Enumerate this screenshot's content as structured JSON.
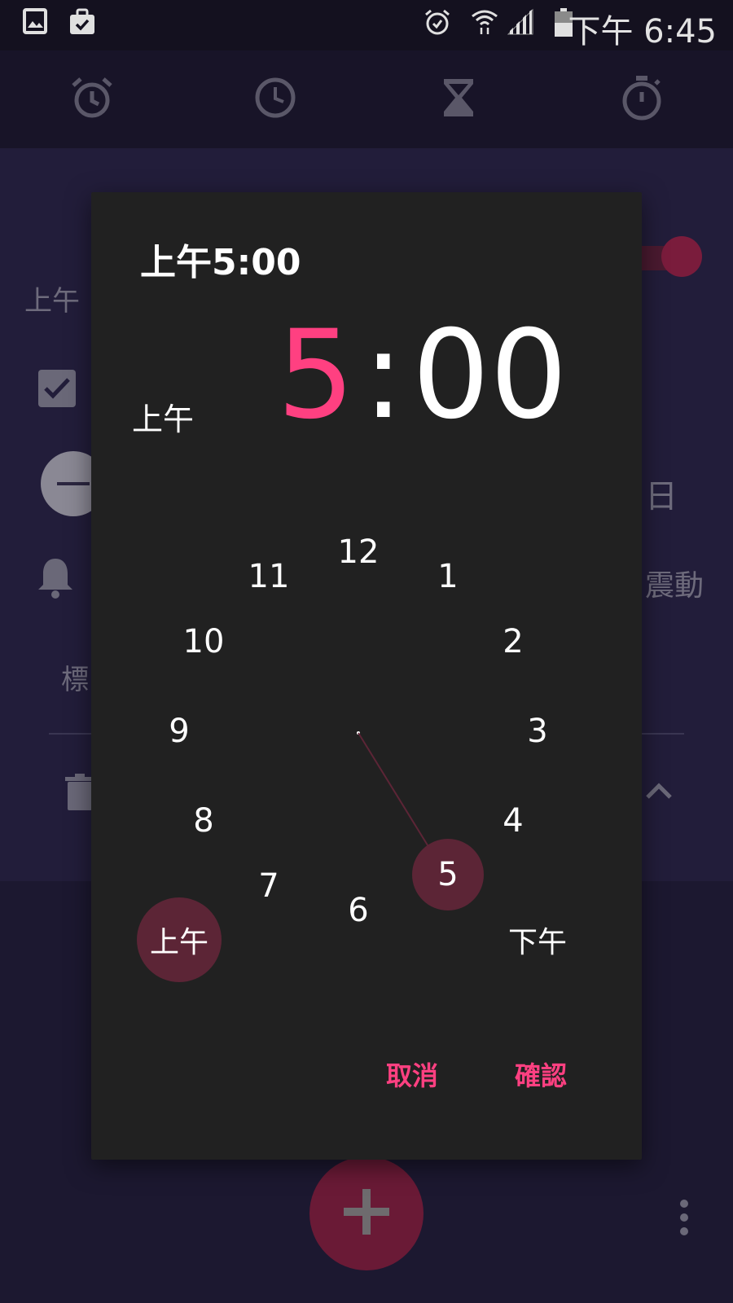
{
  "status_bar": {
    "time": "下午 6:45",
    "left_icons": [
      "image-icon",
      "briefcase-check-icon"
    ],
    "right_icons": [
      "alarm-icon",
      "wifi-icon",
      "signal-icon",
      "battery-icon"
    ]
  },
  "tabs": [
    {
      "icon": "alarm-icon"
    },
    {
      "icon": "clock-icon"
    },
    {
      "icon": "hourglass-icon"
    },
    {
      "icon": "stopwatch-icon"
    }
  ],
  "background": {
    "ampm_fragment": "上午",
    "day_fragment": "日",
    "vibrate_label": "震動",
    "label_fragment": "標"
  },
  "dialog": {
    "title": "上午5:00",
    "ampm_indicator": "上午",
    "hour": "5",
    "separator": ":",
    "minutes": "00",
    "clock_numbers": [
      "12",
      "1",
      "2",
      "3",
      "4",
      "5",
      "6",
      "7",
      "8",
      "9",
      "10",
      "11"
    ],
    "selected_hour": "5",
    "am_label": "上午",
    "pm_label": "下午",
    "selected_period": "am",
    "cancel_label": "取消",
    "ok_label": "確認"
  },
  "colors": {
    "accent": "#ff4081",
    "selector": "#5c2536",
    "dialog_bg": "#212121",
    "app_bg": "#1c1830"
  }
}
